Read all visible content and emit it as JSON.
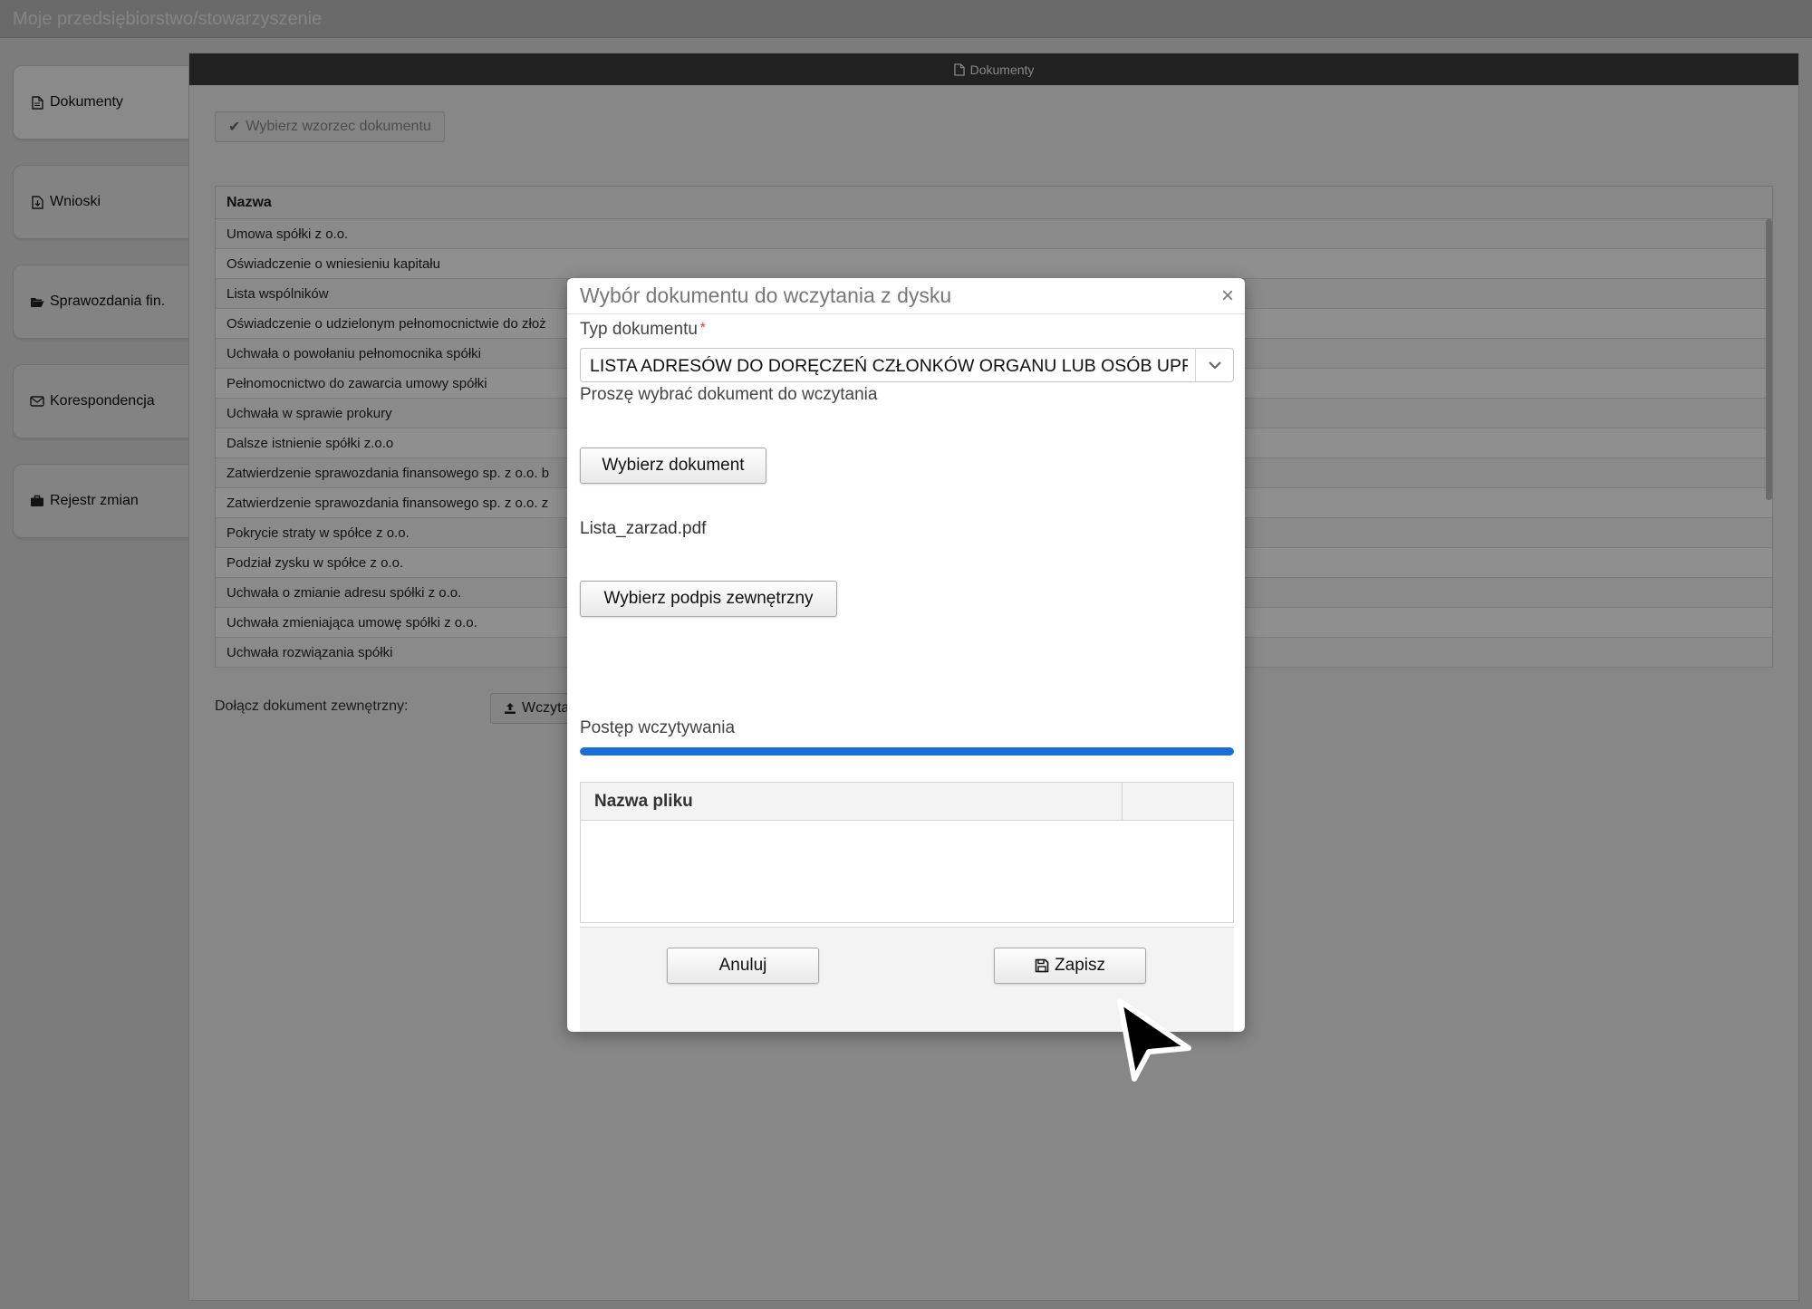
{
  "app": {
    "title": "Moje przedsiębiorstwo/stowarzyszenie"
  },
  "sidebar": {
    "items": [
      {
        "label": "Dokumenty",
        "icon": "document-icon"
      },
      {
        "label": "Wnioski",
        "icon": "document-download-icon"
      },
      {
        "label": "Sprawozdania fin.",
        "icon": "folder-open-icon"
      },
      {
        "label": "Korespondencja",
        "icon": "envelope-icon"
      },
      {
        "label": "Rejestr zmian",
        "icon": "briefcase-icon"
      }
    ]
  },
  "panel": {
    "title": "Dokumenty",
    "pick_template_label": "Wybierz wzorzec dokumentu",
    "table_header": "Nazwa",
    "rows": [
      "Umowa spółki z o.o.",
      "Oświadczenie o wniesieniu kapitału",
      "Lista wspólników",
      "Oświadczenie o udzielonym pełnomocnictwie do złoż",
      "Uchwała o powołaniu pełnomocnika spółki",
      "Pełnomocnictwo do zawarcia umowy spółki",
      "Uchwała w sprawie prokury",
      "Dalsze istnienie spółki z.o.o",
      "Zatwierdzenie sprawozdania finansowego sp. z o.o. b",
      "Zatwierdzenie sprawozdania finansowego sp. z o.o. z",
      "Pokrycie straty w spółce z o.o.",
      "Podział zysku w spółce z o.o.",
      "Uchwała o zmianie adresu spółki z o.o.",
      "Uchwała zmieniająca umowę spółki z o.o.",
      "Uchwała rozwiązania spółki"
    ],
    "attach_label": "Dołącz dokument zewnętrzny:",
    "attach_button": "Wczyta"
  },
  "modal": {
    "title": "Wybór dokumentu do wczytania z dysku",
    "type_label": "Typ dokumentu",
    "required_mark": "*",
    "type_value": "LISTA ADRESÓW  DO  DORĘCZEŃ  CZŁONKÓW ORGANU LUB OSÓB  UPRAWNIONYCH",
    "hint": "Proszę wybrać dokument do wczytania",
    "choose_button": "Wybierz dokument",
    "file_name": "Lista_zarzad.pdf",
    "signature_button": "Wybierz podpis zewnętrzny",
    "progress_label": "Postęp wczytywania",
    "progress_fraction": 1.0,
    "file_table_header": "Nazwa pliku",
    "cancel_button": "Anuluj",
    "save_button": "Zapisz"
  },
  "colors": {
    "progress": "#1a6fd6",
    "overlay": "#000000",
    "header_bar": "#3b3b3b"
  }
}
